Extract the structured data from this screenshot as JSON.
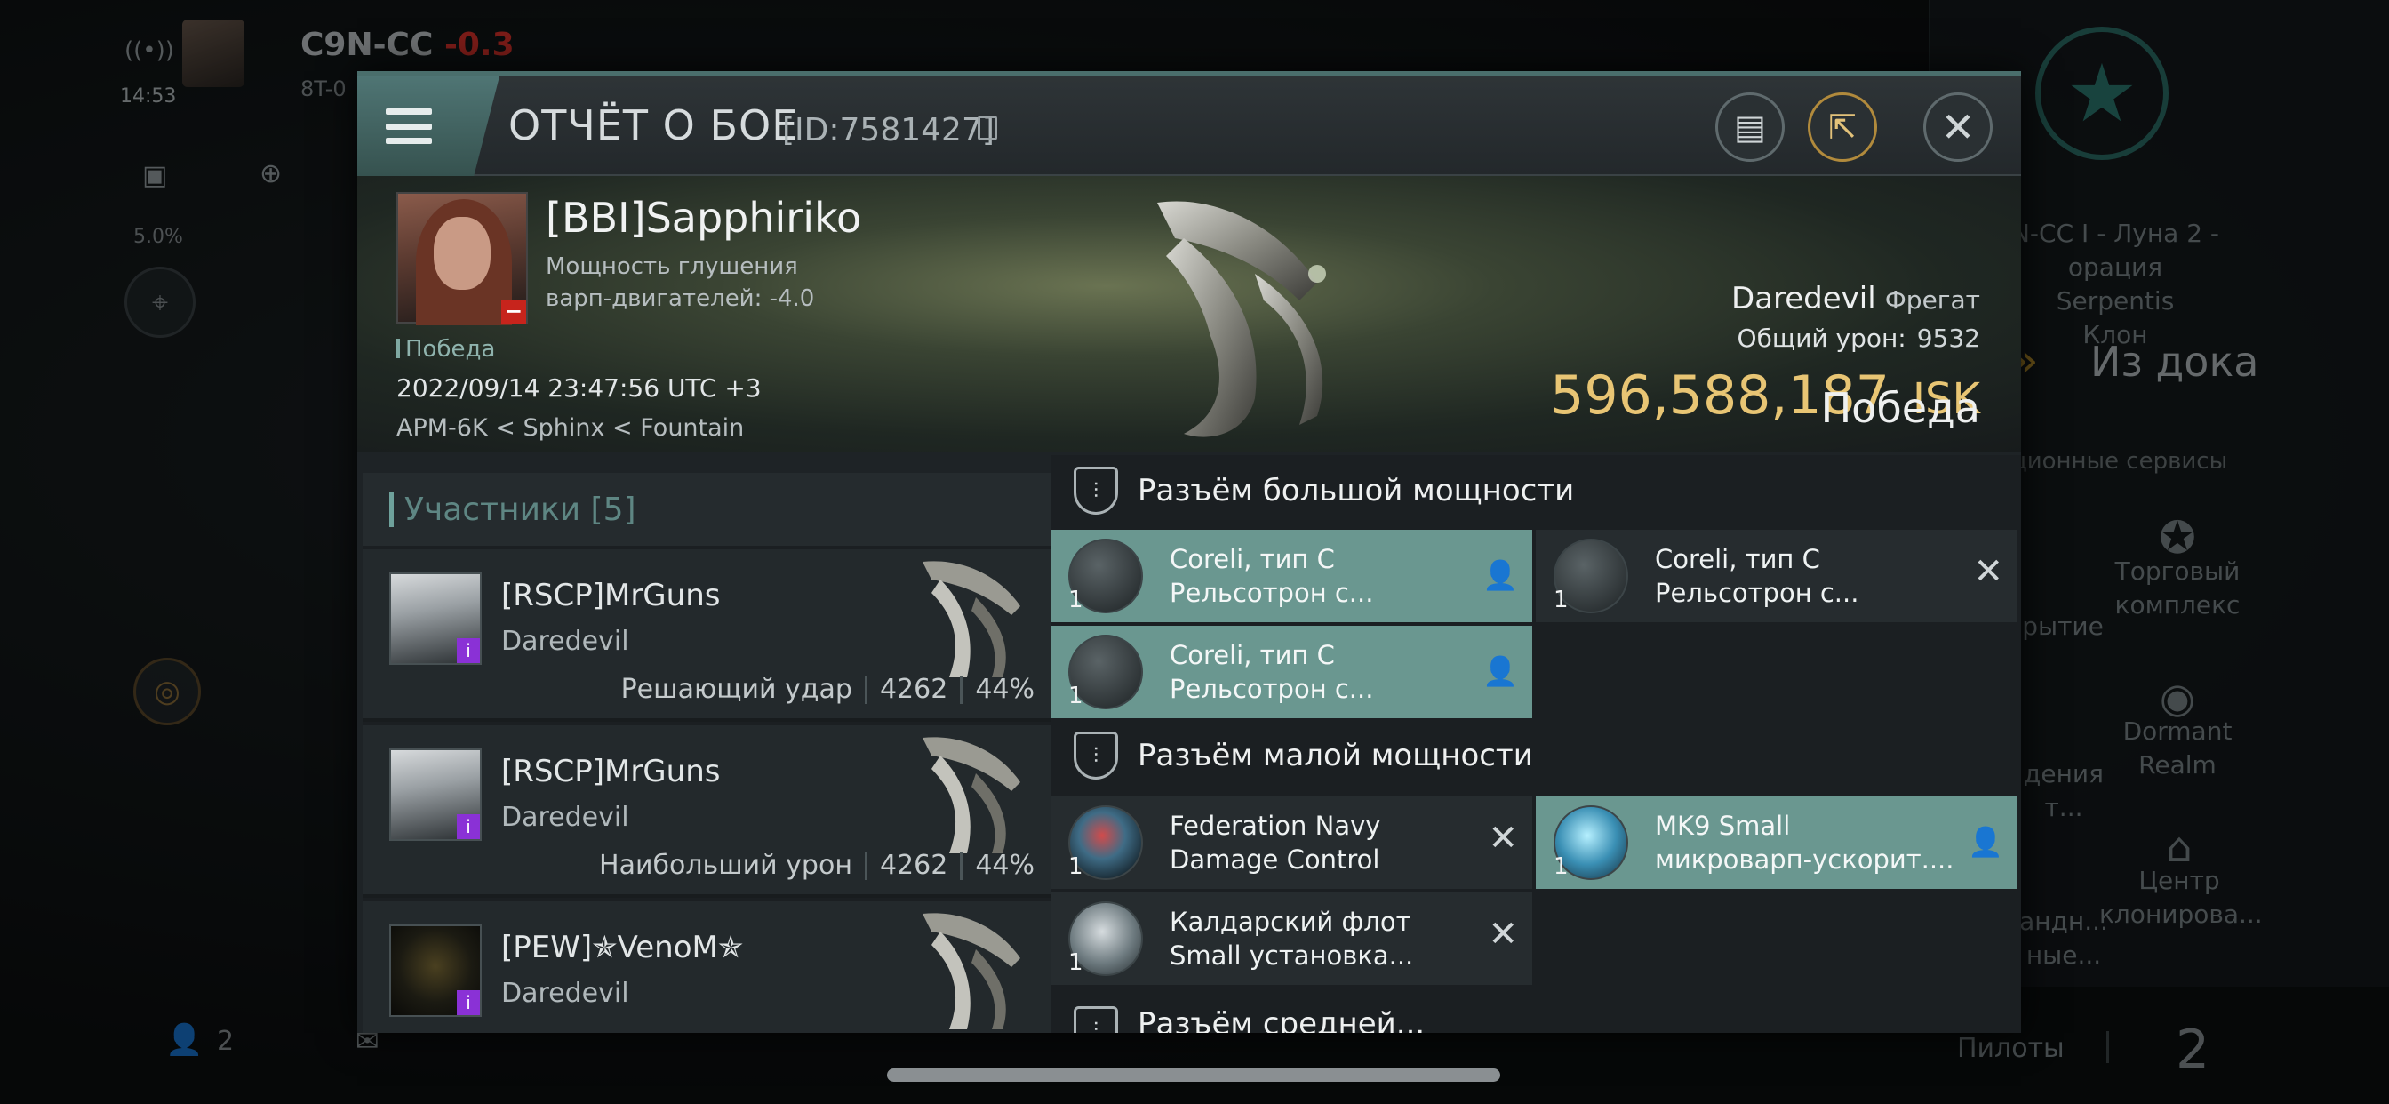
{
  "hud": {
    "system": "C9N-CC",
    "security": "-0.3",
    "subline": "8T-0",
    "time": "14:53",
    "percent": "5.0%",
    "bottom_count": "2"
  },
  "right_panel": {
    "station_line1": "N-CC I - Луна 2 -",
    "station_line2": "орация Serpentis",
    "station_line3": "Клон",
    "undock": "Из дока",
    "services": "ционные сервисы",
    "svc1": "рытие",
    "svc2_l1": "Торговый",
    "svc2_l2": "комплекс",
    "svc3_l1": "дения",
    "svc3_l2": "т...",
    "svc4_l1": "Dormant",
    "svc4_l2": "Realm",
    "svc5_l1": "андн...",
    "svc5_l2": "ные...",
    "svc6_l1": "Центр",
    "svc6_l2": "клонирова...",
    "pilots_label": "Пилоты",
    "pilots_count": "2"
  },
  "modal": {
    "title": "ОТЧЁТ О БОЕ",
    "report_id": "[ID:7581427]",
    "icons": {
      "menu": "menu-icon",
      "report": "clipboard-icon",
      "share": "share-icon",
      "close": "close-icon"
    }
  },
  "victim": {
    "name": "[BBI]Sapphiriko",
    "stat_line1": "Мощность глушения",
    "stat_line2": "варп-двигателей: -4.0",
    "tag": "Победа",
    "datetime": "2022/09/14 23:47:56 UTC +3",
    "location": "APM-6K < Sphinx < Fountain",
    "ship": "Daredevil",
    "ship_class": "Фрегат",
    "total_damage_label": "Общий урон:",
    "total_damage": "9532",
    "isk_value": "596,588,187",
    "isk_unit": "ISK",
    "result": "Победа"
  },
  "participants": {
    "header": "Участники [5]",
    "rows": [
      {
        "name": "[RSCP]MrGuns",
        "ship": "Daredevil",
        "label": "Решающий удар",
        "damage": "4262",
        "percent": "44%"
      },
      {
        "name": "[RSCP]MrGuns",
        "ship": "Daredevil",
        "label": "Наибольший урон",
        "damage": "4262",
        "percent": "44%"
      },
      {
        "name": "[PEW]✯VenoM✯",
        "ship": "Daredevil",
        "label": "",
        "damage": "",
        "percent": ""
      }
    ]
  },
  "fitting": {
    "high_header": "Разъём большой мощности",
    "low_header": "Разъём малой мощности",
    "next_header": "Разъём средней...",
    "high": [
      {
        "line1": "Coreli, тип C",
        "line2": "Рельсотрон с...",
        "qty": "1",
        "status": "fitted"
      },
      {
        "line1": "Coreli, тип C",
        "line2": "Рельсотрон с...",
        "qty": "1",
        "status": "destroyed"
      },
      {
        "line1": "Coreli, тип C",
        "line2": "Рельсотрон с...",
        "qty": "1",
        "status": "fitted"
      }
    ],
    "low": [
      {
        "line1": "Federation Navy",
        "line2": "Damage Control",
        "qty": "1",
        "status": "destroyed"
      },
      {
        "line1": "MK9 Small",
        "line2": "микроварп-ускорит....",
        "qty": "1",
        "status": "fitted"
      },
      {
        "line1": "Калдарский флот",
        "line2": "Small установка...",
        "qty": "1",
        "status": "destroyed"
      }
    ]
  }
}
